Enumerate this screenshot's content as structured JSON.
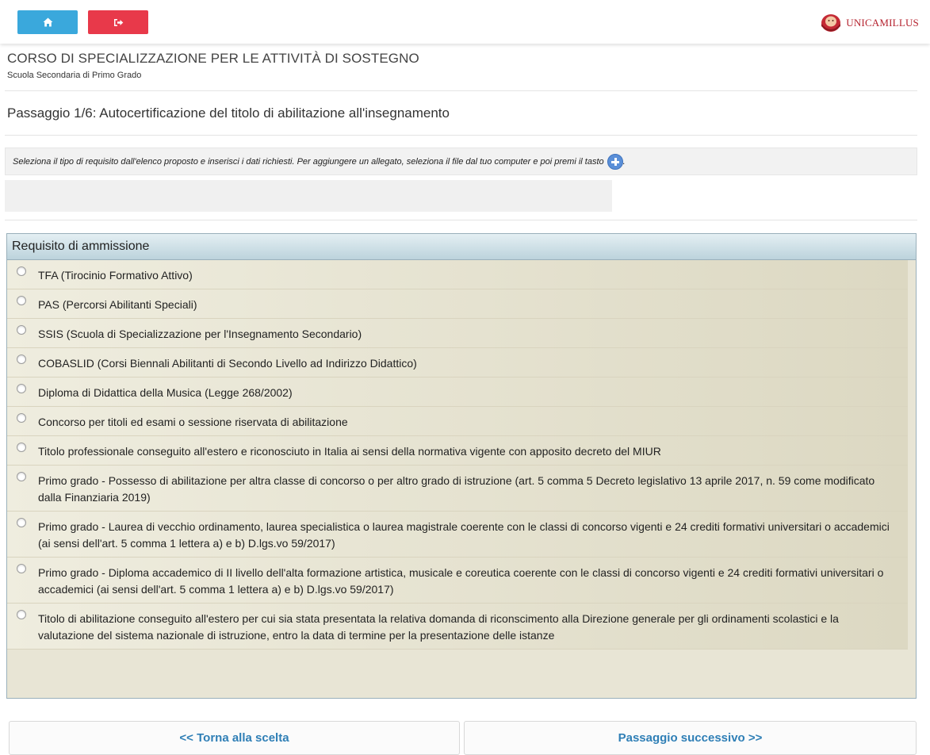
{
  "topbar": {
    "home_icon": "home-icon",
    "logout_icon": "sign-out-icon",
    "logo_text": "UNICAMILLUS",
    "colors": {
      "home": "#3aa8dc",
      "logout": "#e8394a",
      "logo": "#b5232f"
    }
  },
  "header": {
    "title": "CORSO DI SPECIALIZZAZIONE PER LE ATTIVITÀ DI SOSTEGNO",
    "subtitle": "Scuola Secondaria di Primo Grado",
    "step": "Passaggio 1/6: Autocertificazione del titolo di abilitazione all'insegnamento"
  },
  "info": {
    "text": "Seleziona il tipo di requisito dall'elenco proposto e inserisci i dati richiesti. Per aggiungere un allegato, seleziona il file dal tuo computer e poi premi il tasto",
    "icon": "plus-circle-icon"
  },
  "requisiti": {
    "header": "Requisito di ammissione",
    "options": [
      "TFA (Tirocinio Formativo Attivo)",
      "PAS (Percorsi Abilitanti Speciali)",
      "SSIS (Scuola di Specializzazione per l'Insegnamento Secondario)",
      "COBASLID (Corsi Biennali Abilitanti di Secondo Livello ad Indirizzo Didattico)",
      "Diploma di Didattica della Musica (Legge 268/2002)",
      "Concorso per titoli ed esami o sessione riservata di abilitazione",
      "Titolo professionale conseguito all'estero e riconosciuto in Italia ai sensi della normativa vigente con apposito decreto del MIUR",
      "Primo grado - Possesso di abilitazione per altra classe di concorso o per altro grado di istruzione (art. 5 comma 5 Decreto legislativo 13 aprile 2017, n. 59 come modificato dalla Finanziaria 2019)",
      "Primo grado - Laurea di vecchio ordinamento, laurea specialistica o laurea magistrale coerente con le classi di concorso vigenti e 24 crediti formativi universitari o accademici (ai sensi dell'art. 5 comma 1 lettera a) e b) D.lgs.vo 59/2017)",
      "Primo grado - Diploma accademico di II livello dell'alta formazione artistica, musicale e coreutica coerente con le classi di concorso vigenti e 24 crediti formativi universitari o accademici (ai sensi dell'art. 5 comma 1 lettera a) e b) D.lgs.vo 59/2017)",
      "Titolo di abilitazione conseguito all'estero per cui sia stata presentata la relativa domanda di riconscimento alla Direzione generale per gli ordinamenti scolastici e la valutazione del sistema nazionale di istruzione, entro la data di termine per la presentazione delle istanze"
    ]
  },
  "footer": {
    "back_label": "<< Torna alla scelta",
    "next_label": "Passaggio successivo >>"
  }
}
